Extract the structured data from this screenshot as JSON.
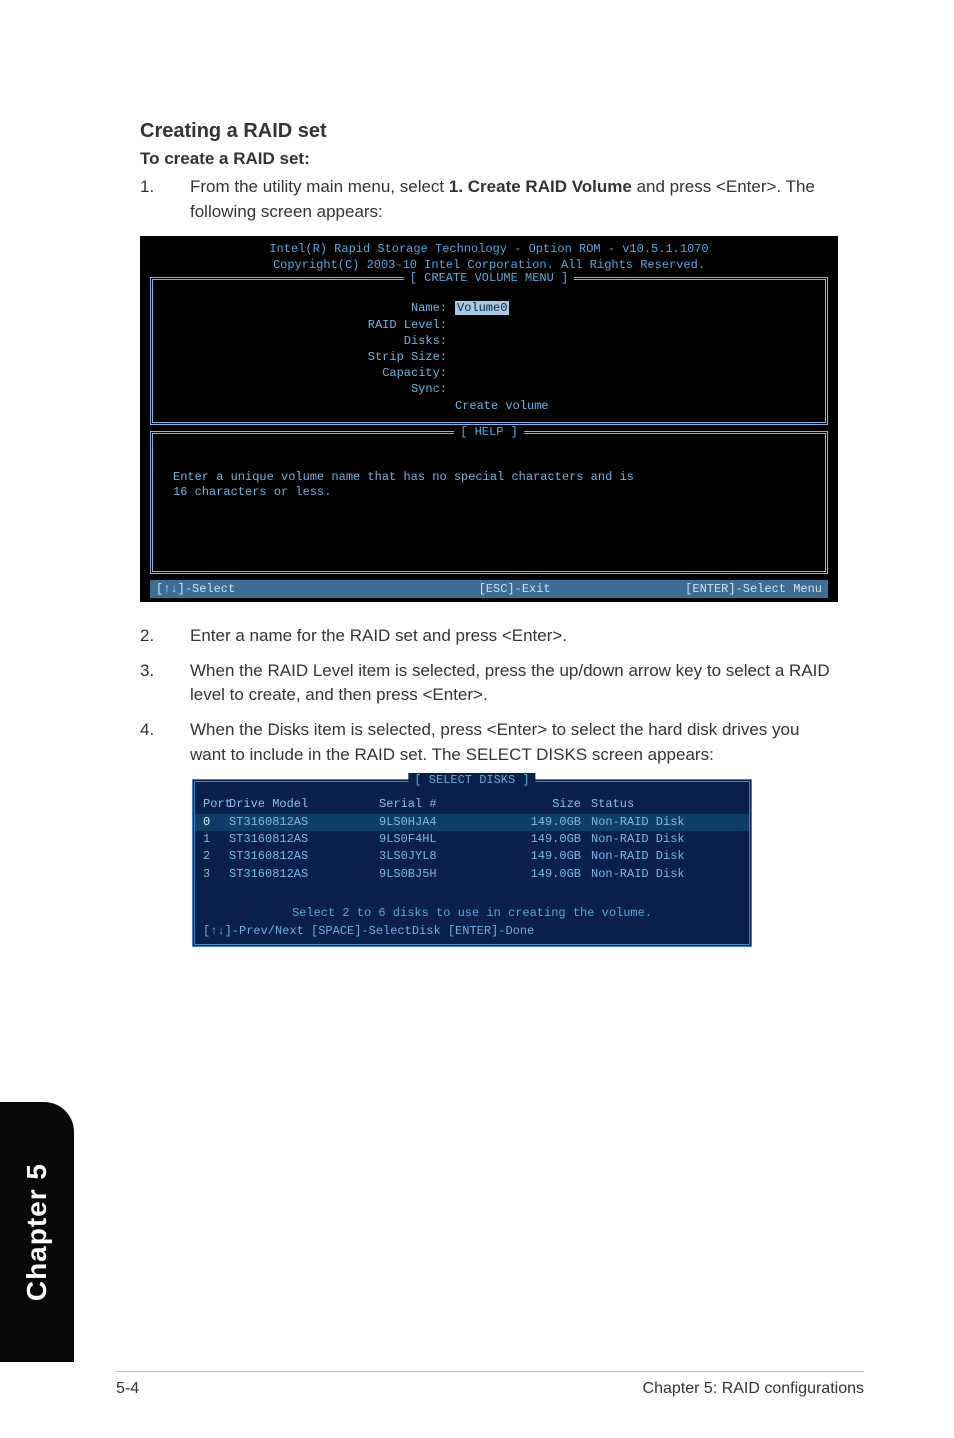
{
  "heading": "Creating a RAID set",
  "subheading": "To create a RAID set:",
  "step1": {
    "num": "1.",
    "prefix": "From the utility main menu, select ",
    "bold": "1. Create RAID Volume",
    "suffix": " and press <Enter>. The following screen appears:"
  },
  "bios1": {
    "title1": "Intel(R) Rapid Storage Technology - Option ROM - v10.5.1.1070",
    "title2": "Copyright(C) 2003-10 Intel Corporation.  All Rights Reserved.",
    "menu_legend": "[ CREATE VOLUME MENU ]",
    "fields": {
      "name_label": "Name:",
      "name_value": "Volume0",
      "raid_level": "RAID Level:",
      "disks": "Disks:",
      "strip_size": "Strip Size:",
      "capacity": "Capacity:",
      "sync": "Sync:",
      "create_volume": "Create volume"
    },
    "help_legend": "[ HELP ]",
    "help_line1": "Enter a unique volume name that has no special characters and is",
    "help_line2": "16 characters or less.",
    "footer": {
      "select": "[↑↓]-Select",
      "exit": "[ESC]-Exit",
      "enter": "[ENTER]-Select Menu"
    }
  },
  "step2": {
    "num": "2.",
    "text": "Enter a name for the RAID set and press <Enter>."
  },
  "step3": {
    "num": "3.",
    "text": "When the RAID Level item is selected, press the up/down arrow key to select a RAID level to create, and then press <Enter>."
  },
  "step4": {
    "num": "4.",
    "text": "When the Disks item is selected, press <Enter> to select the hard disk drives you want to include in the RAID set. The SELECT DISKS screen appears:"
  },
  "bios2": {
    "legend": "[ SELECT DISKS ]",
    "headers": {
      "port": "Port",
      "drive_model": "Drive Model",
      "serial": "Serial #",
      "size": "Size",
      "status": "Status"
    },
    "rows": [
      {
        "port": "0",
        "model": "ST3160812AS",
        "serial": "9LS0HJA4",
        "size": "149.0GB",
        "status": "Non-RAID Disk",
        "selected": true
      },
      {
        "port": "1",
        "model": "ST3160812AS",
        "serial": "9LS0F4HL",
        "size": "149.0GB",
        "status": "Non-RAID Disk",
        "selected": false
      },
      {
        "port": "2",
        "model": "ST3160812AS",
        "serial": "3LS0JYL8",
        "size": "149.0GB",
        "status": "Non-RAID Disk",
        "selected": false
      },
      {
        "port": "3",
        "model": "ST3160812AS",
        "serial": "9LS0BJ5H",
        "size": "149.0GB",
        "status": "Non-RAID Disk",
        "selected": false
      }
    ],
    "msg": "Select 2 to 6 disks to use in creating the volume.",
    "nav": "[↑↓]-Prev/Next [SPACE]-SelectDisk [ENTER]-Done"
  },
  "side_tab": "Chapter 5",
  "footer_left": "5-4",
  "footer_right": "Chapter 5: RAID configurations"
}
